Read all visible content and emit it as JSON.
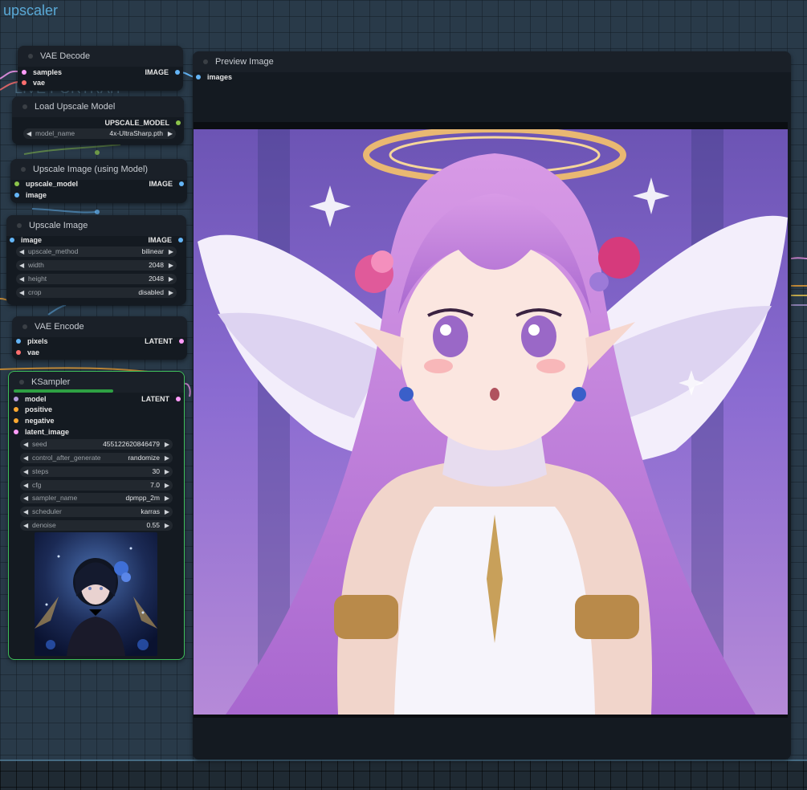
{
  "group": {
    "title": "upscaler",
    "bg_label": "LIVE PORTRAIT"
  },
  "colors": {
    "image_pin": "#64b5f6",
    "latent_pin": "#ff9cf9",
    "model_pin": "#b39ddb",
    "vae_pin": "#ff6e6e",
    "cond_pin": "#ffa931",
    "upscale_pin": "#8bc34a"
  },
  "nodes": {
    "vae_decode": {
      "title": "VAE Decode",
      "inputs": [
        "samples",
        "vae"
      ],
      "output": "IMAGE"
    },
    "load_upscale_model": {
      "title": "Load Upscale Model",
      "output": "UPSCALE_MODEL",
      "widgets": [
        {
          "label": "model_name",
          "value": "4x-UltraSharp.pth"
        }
      ]
    },
    "upscale_image_model": {
      "title": "Upscale Image (using Model)",
      "inputs": [
        "upscale_model",
        "image"
      ],
      "output": "IMAGE"
    },
    "upscale_image": {
      "title": "Upscale Image",
      "inputs": [
        "image"
      ],
      "output": "IMAGE",
      "widgets": [
        {
          "label": "upscale_method",
          "value": "bilinear"
        },
        {
          "label": "width",
          "value": "2048"
        },
        {
          "label": "height",
          "value": "2048"
        },
        {
          "label": "crop",
          "value": "disabled"
        }
      ]
    },
    "vae_encode": {
      "title": "VAE Encode",
      "inputs": [
        "pixels",
        "vae"
      ],
      "output": "LATENT"
    },
    "ksampler": {
      "title": "KSampler",
      "progress": 0.6,
      "inputs": [
        "model",
        "positive",
        "negative",
        "latent_image"
      ],
      "output": "LATENT",
      "widgets": [
        {
          "label": "seed",
          "value": "455122620846479"
        },
        {
          "label": "control_after_generate",
          "value": "randomize"
        },
        {
          "label": "steps",
          "value": "30"
        },
        {
          "label": "cfg",
          "value": "7.0"
        },
        {
          "label": "sampler_name",
          "value": "dpmpp_2m"
        },
        {
          "label": "scheduler",
          "value": "karras"
        },
        {
          "label": "denoise",
          "value": "0.55"
        }
      ]
    },
    "preview_image": {
      "title": "Preview Image",
      "inputs": [
        "images"
      ]
    }
  }
}
